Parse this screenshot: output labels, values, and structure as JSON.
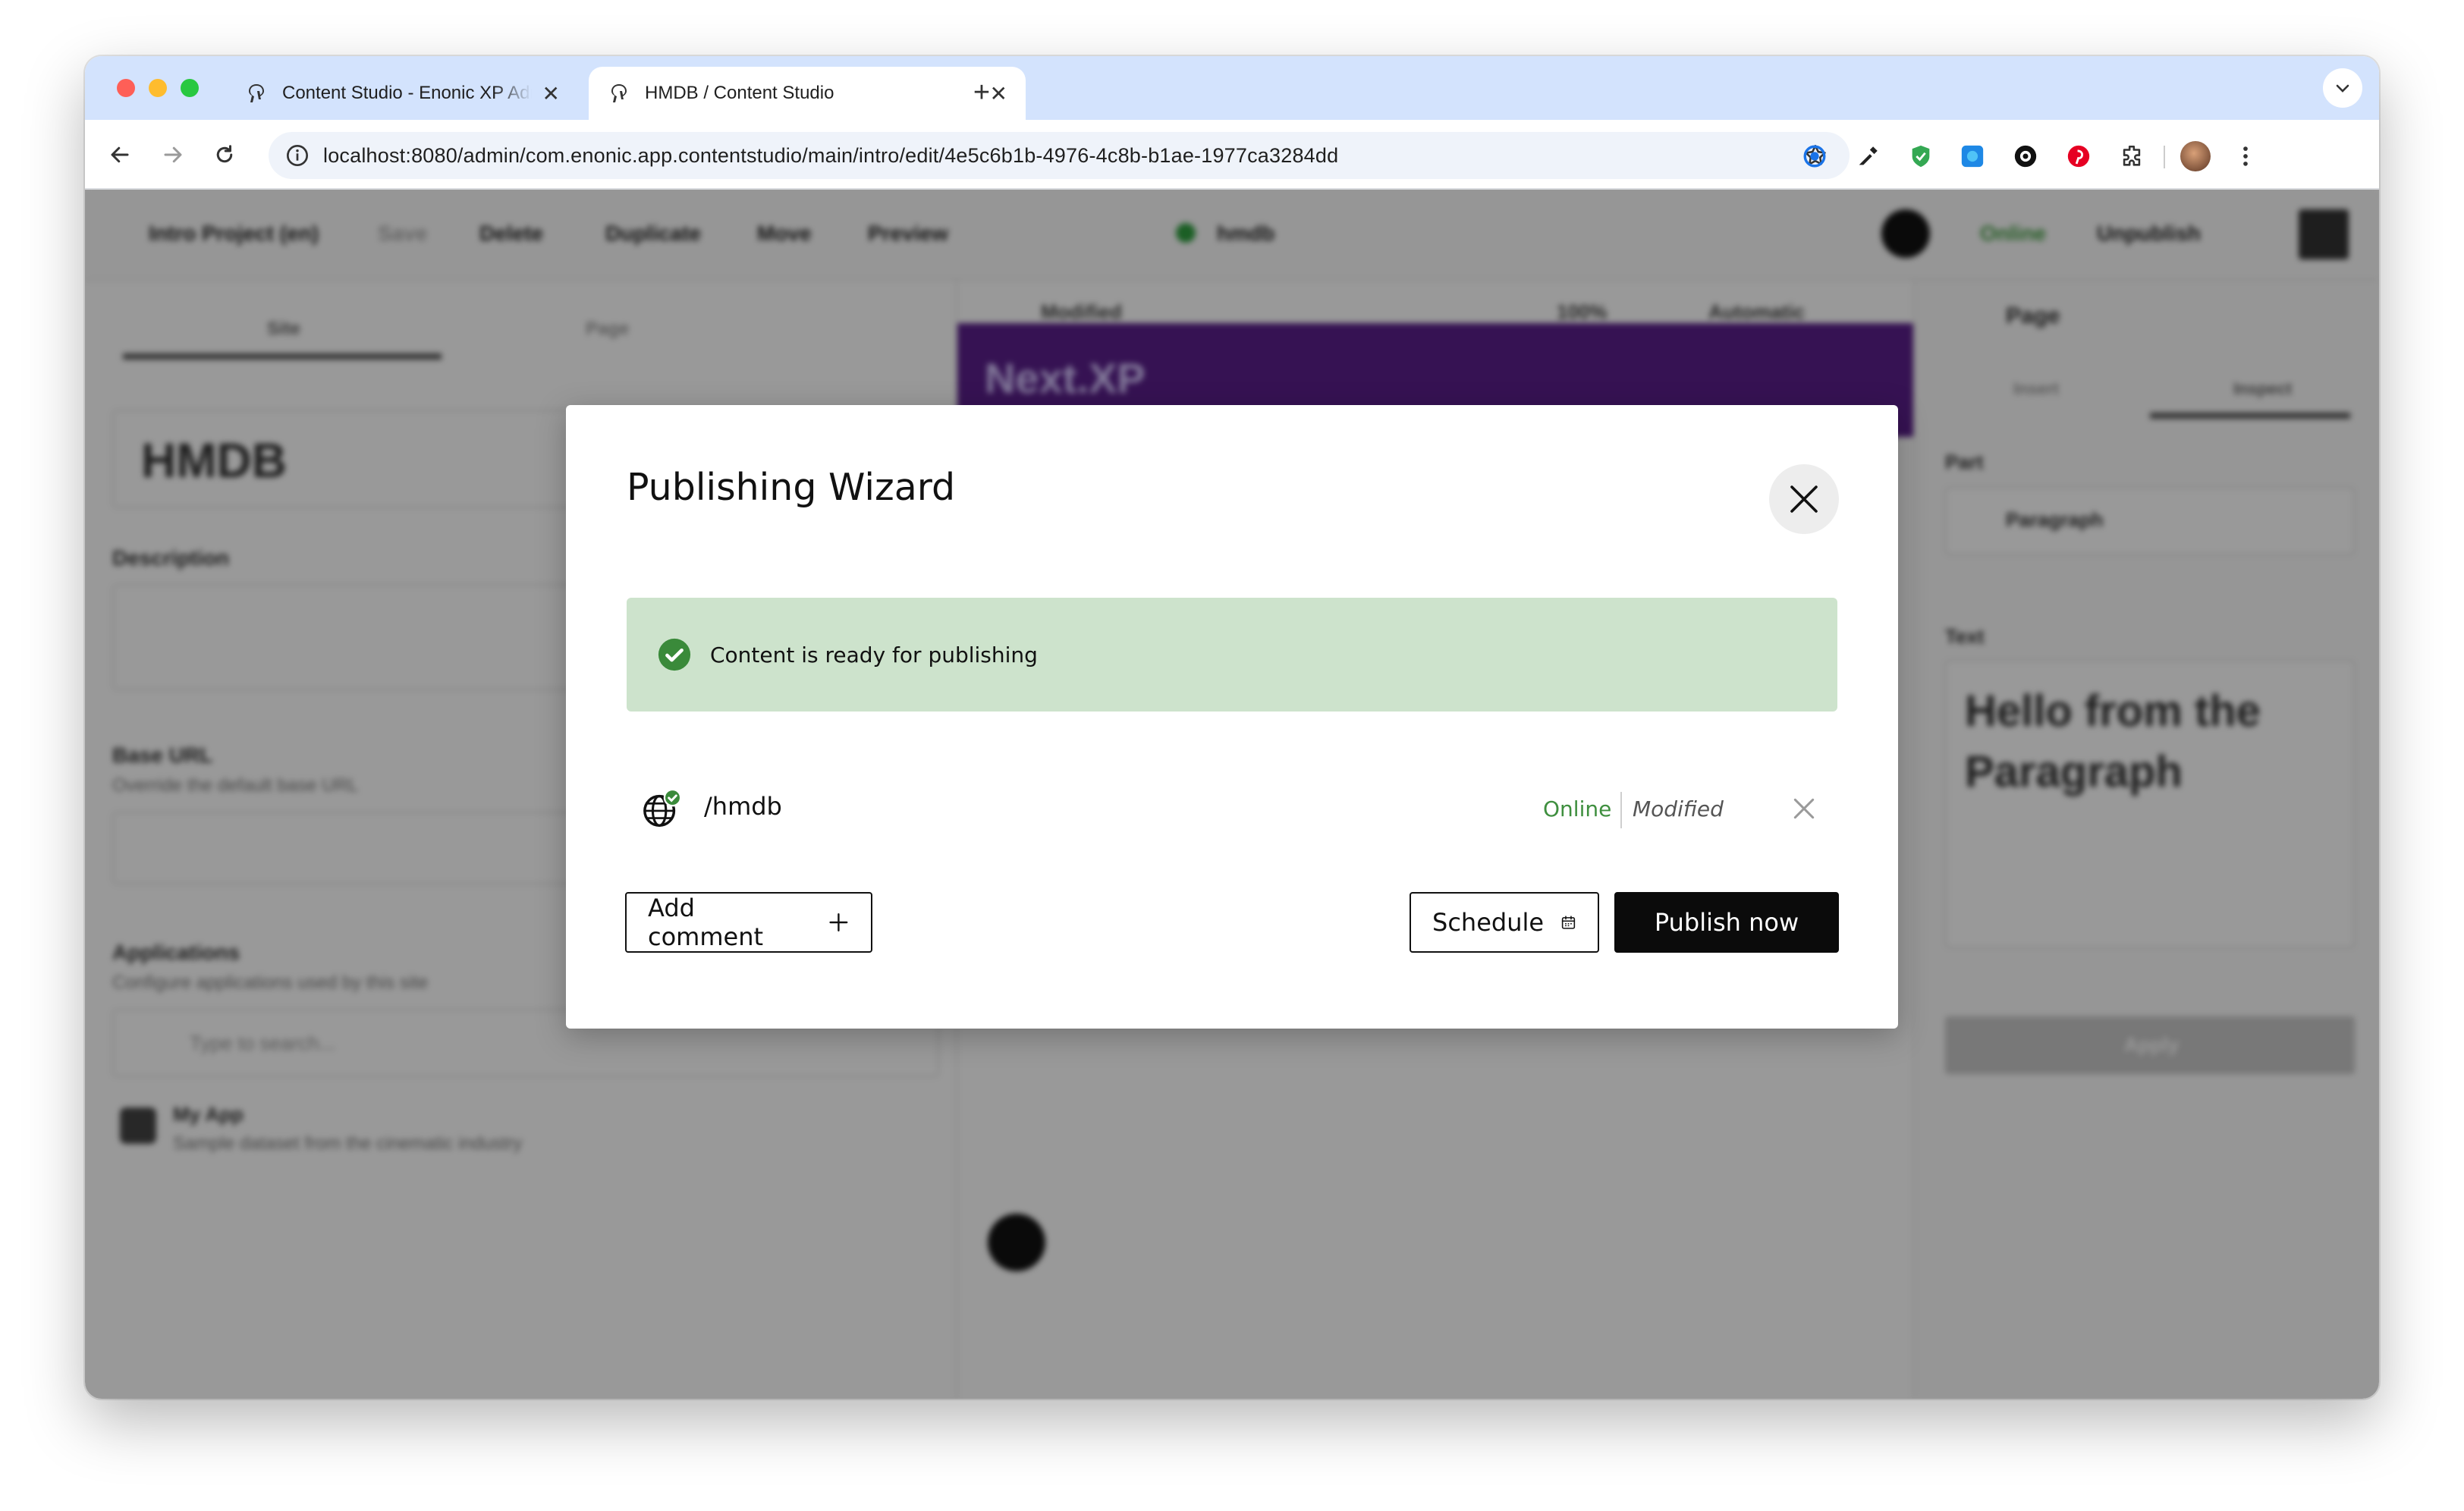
{
  "browser": {
    "tabs": [
      {
        "title": "Content Studio - Enonic XP Admin",
        "active": false
      },
      {
        "title": "HMDB / Content Studio",
        "active": true
      }
    ],
    "url": "localhost:8080/admin/com.enonic.app.contentstudio/main/intro/edit/4e5c6b1b-4976-4c8b-b1ae-1977ca3284dd"
  },
  "background_app": {
    "project": "Intro Project (en)",
    "toolbar_actions": [
      "Save",
      "Delete",
      "Duplicate",
      "Move",
      "Preview"
    ],
    "user": "hmdb",
    "status": "Online",
    "unpublish": "Unpublish",
    "left_tabs": [
      "Site",
      "Page"
    ],
    "display_name": "HMDB",
    "fields": [
      "Description",
      "Base URL",
      "Applications"
    ],
    "base_url_help": "Override the default base URL",
    "applications_help": "Configure applications used by this site",
    "search_placeholder": "Type to search...",
    "app_name": "My App",
    "app_description": "Sample dataset from the cinematic industry",
    "preview_status": "Modified",
    "zoom": "100%",
    "device": "Automatic",
    "preview_banner": "Next.XP",
    "inspect_header": "Page",
    "inspect_tabs": [
      "Insert",
      "Inspect"
    ],
    "part_label": "Part",
    "part_value": "Paragraph",
    "text_label": "Text",
    "text_value": "Hello from the Paragraph",
    "apply_label": "Apply"
  },
  "dialog": {
    "title": "Publishing Wizard",
    "ready_message": "Content is ready for publishing",
    "items": [
      {
        "path": "/hmdb",
        "status": "Online",
        "state": "Modified"
      }
    ],
    "add_comment": "Add comment",
    "schedule": "Schedule",
    "publish_now": "Publish now"
  },
  "colors": {
    "ready_bg": "#cde3cc",
    "online_green": "#3f8f3f",
    "check_green": "#3a8a3a",
    "primary_button": "#0b0b0b"
  },
  "icons": [
    "close-icon",
    "check-circle-icon",
    "globe-icon",
    "plus-icon",
    "calendar-icon"
  ]
}
